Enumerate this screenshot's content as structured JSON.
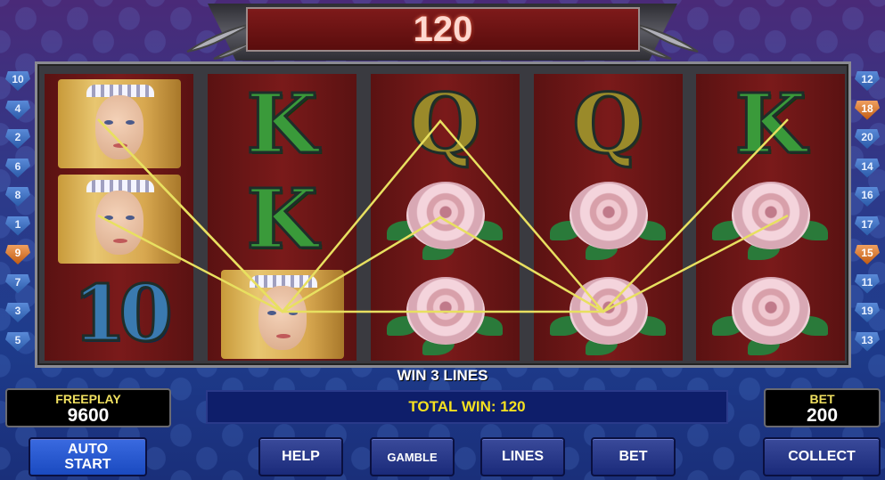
{
  "top_banner": {
    "win_amount": "120"
  },
  "reels": [
    [
      "lady",
      "lady",
      "10"
    ],
    [
      "K",
      "K",
      "lady"
    ],
    [
      "Q",
      "rose",
      "rose"
    ],
    [
      "Q",
      "rose",
      "rose"
    ],
    [
      "K",
      "rose",
      "rose"
    ]
  ],
  "symbol_text": {
    "K": "K",
    "Q": "Q",
    "10": "10"
  },
  "left_gems": [
    "10",
    "4",
    "2",
    "6",
    "8",
    "1",
    "9",
    "7",
    "3",
    "5"
  ],
  "right_gems": [
    "12",
    "18",
    "20",
    "14",
    "16",
    "17",
    "15",
    "11",
    "19",
    "13"
  ],
  "highlighted_gems": [
    "9",
    "18",
    "15"
  ],
  "win_lines_text": "WIN 3 LINES",
  "freeplay": {
    "label": "FREEPLAY",
    "value": "9600"
  },
  "bet_box": {
    "label": "BET",
    "value": "200"
  },
  "total_win_text": "TOTAL WIN: 120",
  "buttons": {
    "auto_start_line1": "AUTO",
    "auto_start_line2": "START",
    "help": "HELP",
    "gamble": "GAMBLE",
    "lines": "LINES",
    "bet": "BET",
    "collect": "COLLECT"
  },
  "colors": {
    "win_line": "#e8e060",
    "gem_normal": "#2a5aa8",
    "gem_highlight": "#c05a10",
    "total_win_text": "#f4e020"
  }
}
